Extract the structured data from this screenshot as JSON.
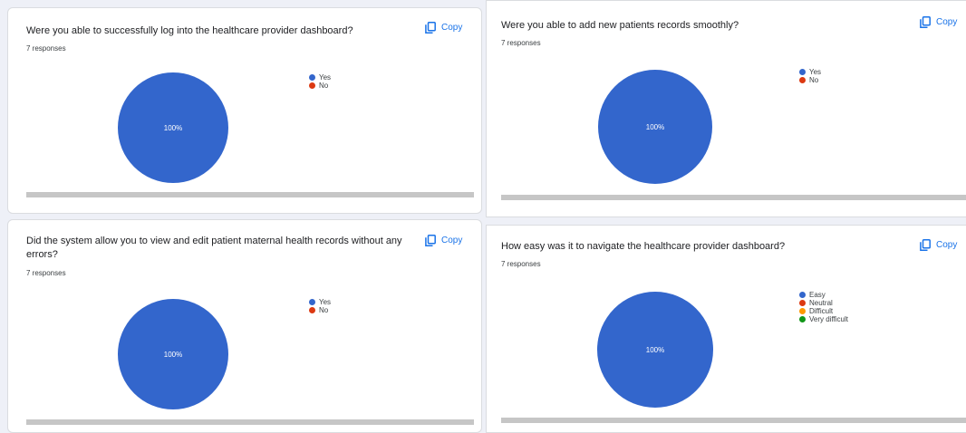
{
  "copy_label": "Copy",
  "colors": {
    "yes": "#3366cc",
    "no": "#dc3912",
    "difficult": "#ff9900",
    "very_difficult": "#109618"
  },
  "cards": [
    {
      "question": "Were you able to successfully log into the healthcare provider dashboard?",
      "responses": "7 responses",
      "legend": [
        {
          "label": "Yes",
          "color": "#3366cc"
        },
        {
          "label": "No",
          "color": "#dc3912"
        }
      ],
      "slice_label": "100%"
    },
    {
      "question": "Were you able to add new patients records smoothly?",
      "responses": "7 responses",
      "legend": [
        {
          "label": "Yes",
          "color": "#3366cc"
        },
        {
          "label": "No",
          "color": "#dc3912"
        }
      ],
      "slice_label": "100%"
    },
    {
      "question": "Did the system allow you to view and edit patient maternal health records without any errors?",
      "responses": "7 responses",
      "legend": [
        {
          "label": "Yes",
          "color": "#3366cc"
        },
        {
          "label": "No",
          "color": "#dc3912"
        }
      ],
      "slice_label": "100%"
    },
    {
      "question": "How easy was it to navigate the healthcare provider dashboard?",
      "responses": "7 responses",
      "legend": [
        {
          "label": "Easy",
          "color": "#3366cc"
        },
        {
          "label": "Neutral",
          "color": "#dc3912"
        },
        {
          "label": "Difficult",
          "color": "#ff9900"
        },
        {
          "label": "Very difficult",
          "color": "#109618"
        }
      ],
      "slice_label": "100%"
    }
  ],
  "chart_data": [
    {
      "type": "pie",
      "title": "Were you able to successfully log into the healthcare provider dashboard?",
      "categories": [
        "Yes",
        "No"
      ],
      "values": [
        100,
        0
      ],
      "legend": "right"
    },
    {
      "type": "pie",
      "title": "Were you able to add new patients records smoothly?",
      "categories": [
        "Yes",
        "No"
      ],
      "values": [
        100,
        0
      ],
      "legend": "right"
    },
    {
      "type": "pie",
      "title": "Did the system allow you to view and edit patient maternal health records without any errors?",
      "categories": [
        "Yes",
        "No"
      ],
      "values": [
        100,
        0
      ],
      "legend": "right"
    },
    {
      "type": "pie",
      "title": "How easy was it to navigate the healthcare provider dashboard?",
      "categories": [
        "Easy",
        "Neutral",
        "Difficult",
        "Very difficult"
      ],
      "values": [
        100,
        0,
        0,
        0
      ],
      "legend": "right"
    }
  ]
}
